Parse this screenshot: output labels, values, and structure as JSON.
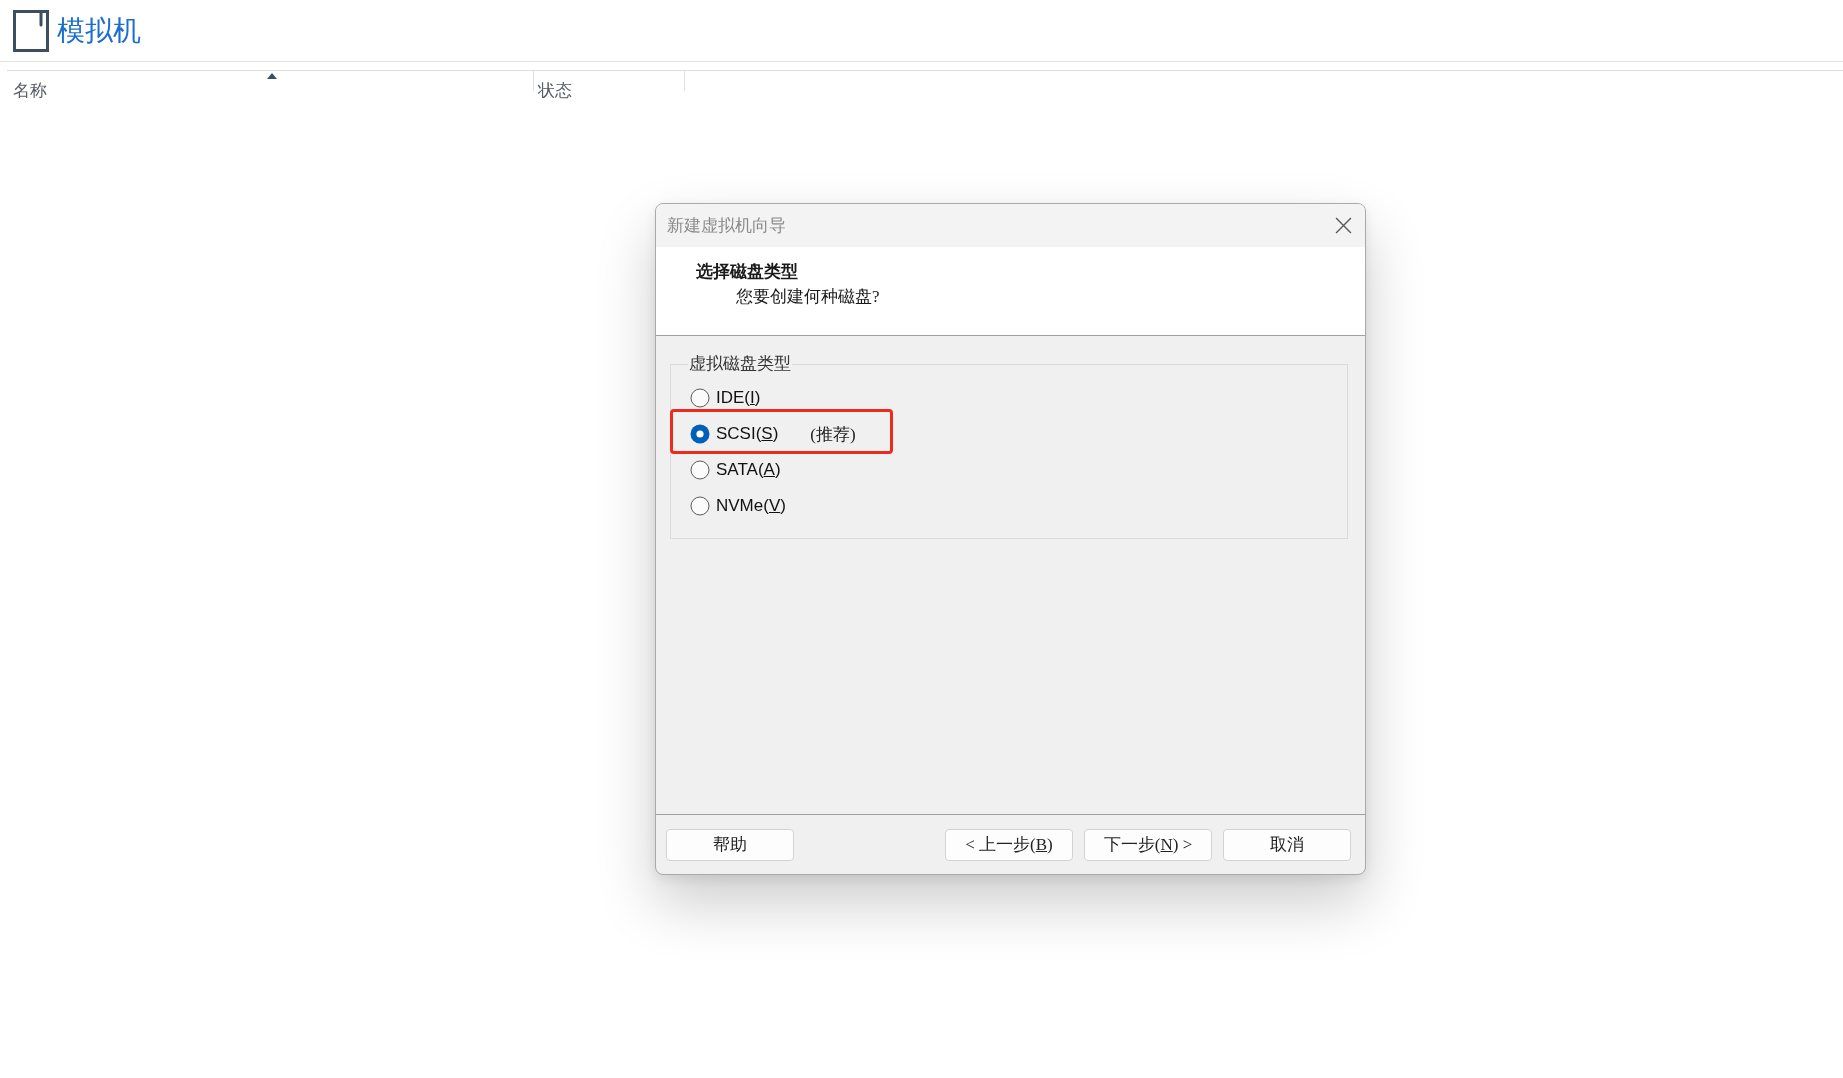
{
  "app_header": {
    "title": "模拟机"
  },
  "table": {
    "columns": [
      {
        "label": "名称",
        "sorted": true
      },
      {
        "label": "状态",
        "sorted": false
      }
    ]
  },
  "dialog": {
    "title": "新建虚拟机向导",
    "heading": "选择磁盘类型",
    "subheading": "您要创建何种磁盘?",
    "disk_type_group": {
      "label": "虚拟磁盘类型",
      "options": [
        {
          "text": "IDE(",
          "mnemonic": "I",
          "text_after": ")",
          "selected": false,
          "highlighted": false
        },
        {
          "text": "SCSI(",
          "mnemonic": "S",
          "text_after": ")",
          "note": "(推荐)",
          "selected": true,
          "highlighted": true
        },
        {
          "text": "SATA(",
          "mnemonic": "A",
          "text_after": ")",
          "selected": false,
          "highlighted": false
        },
        {
          "text": "NVMe(",
          "mnemonic": "V",
          "text_after": ")",
          "selected": false,
          "highlighted": false
        }
      ]
    },
    "buttons": [
      {
        "kind": "help",
        "text": "帮助"
      },
      {
        "kind": "back",
        "text": "< 上一步(",
        "mnemonic": "B",
        "text_after": ")"
      },
      {
        "kind": "next",
        "text": "下一步(",
        "mnemonic": "N",
        "text_after": ") >"
      },
      {
        "kind": "cancel",
        "text": "取消"
      }
    ]
  }
}
